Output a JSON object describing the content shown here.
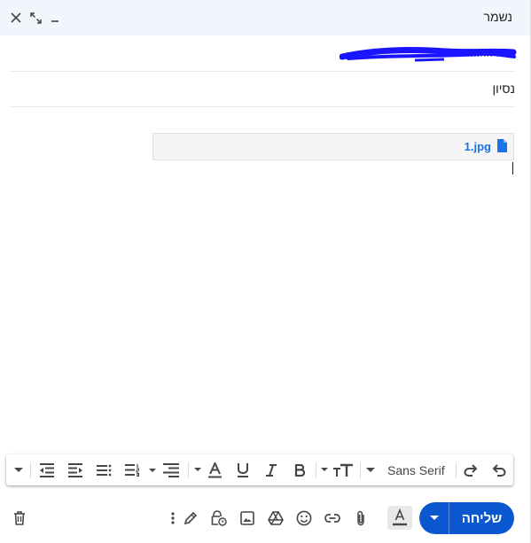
{
  "header": {
    "title": "נשמר"
  },
  "to": {
    "recipients": "...... ....... ....... ......"
  },
  "subject": {
    "value": "נסיון"
  },
  "attachment": {
    "filename": "1.jpg"
  },
  "format_toolbar": {
    "font": "Sans Serif"
  },
  "send_button": {
    "label": "שליחה"
  },
  "colors": {
    "accent": "#0b57d0",
    "link": "#1a73e8",
    "scribble": "#1a14ff"
  }
}
